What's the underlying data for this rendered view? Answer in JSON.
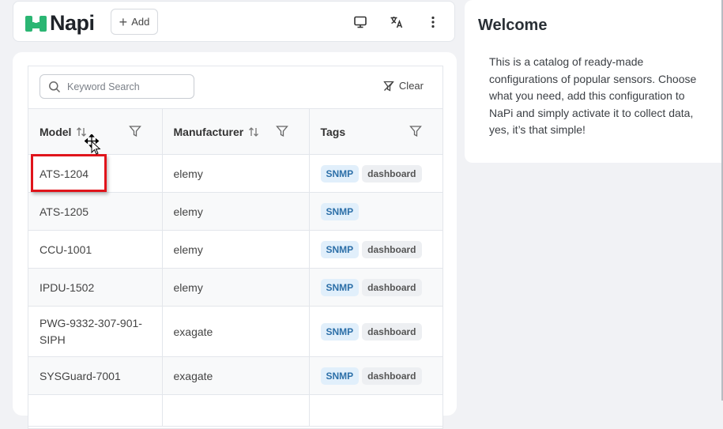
{
  "header": {
    "brand": "Napi",
    "add_label": "Add",
    "icons": [
      "monitor-icon",
      "translate-icon",
      "more-vertical-icon"
    ]
  },
  "search": {
    "placeholder": "Keyword Search",
    "clear_label": "Clear"
  },
  "table": {
    "columns": [
      "Model",
      "Manufacturer",
      "Tags"
    ],
    "rows": [
      {
        "model": "ATS-1204",
        "manufacturer": "elemy",
        "tags": [
          "SNMP",
          "dashboard"
        ]
      },
      {
        "model": "ATS-1205",
        "manufacturer": "elemy",
        "tags": [
          "SNMP"
        ]
      },
      {
        "model": "CCU-1001",
        "manufacturer": "elemy",
        "tags": [
          "SNMP",
          "dashboard"
        ]
      },
      {
        "model": "IPDU-1502",
        "manufacturer": "elemy",
        "tags": [
          "SNMP",
          "dashboard"
        ]
      },
      {
        "model": "PWG-9332-307-901-SIPH",
        "manufacturer": "exagate",
        "tags": [
          "SNMP",
          "dashboard"
        ]
      },
      {
        "model": "SYSGuard-7001",
        "manufacturer": "exagate",
        "tags": [
          "SNMP",
          "dashboard"
        ]
      }
    ]
  },
  "welcome": {
    "title": "Welcome",
    "body": "This is a catalog of ready-made configurations of popular sensors. Choose what you need, add this configuration to NaPi and simply activate it to collect data, yes, it’s that simple!"
  },
  "colors": {
    "brand_green": "#2bb673",
    "highlight": "#e0141b",
    "snmp_bg": "#e1effb",
    "snmp_text": "#2c6fa8"
  }
}
